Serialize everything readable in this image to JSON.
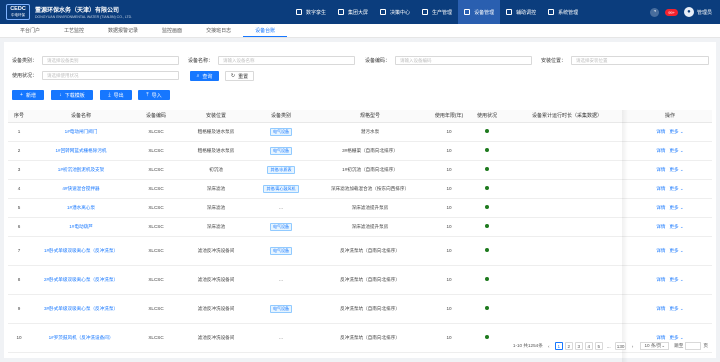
{
  "header": {
    "logo_badge": "CEDC",
    "logo_badge_sub": "中电环保",
    "company_name": "董源环保水务（天津）有限公司",
    "company_en": "DONGYUAN ENVIRONMENTAL WATER (TIANJIN) CO., LTD.",
    "nav": [
      {
        "label": "数字孪生",
        "icon": "twin-icon"
      },
      {
        "label": "集团大屏",
        "icon": "screen-icon"
      },
      {
        "label": "决策中心",
        "icon": "decision-icon"
      },
      {
        "label": "生产管理",
        "icon": "production-icon"
      },
      {
        "label": "设备管理",
        "icon": "device-icon"
      },
      {
        "label": "辅助调控",
        "icon": "control-icon"
      },
      {
        "label": "系统管理",
        "icon": "system-icon"
      }
    ],
    "active_nav": 4,
    "notification_count": "99+",
    "user_name": "管理员"
  },
  "tabs": [
    "平台门户",
    "工艺监控",
    "数据报警记录",
    "监控画面",
    "交接班日志",
    "设备台账"
  ],
  "active_tab": 5,
  "filters": {
    "device_category_label": "设备类别：",
    "device_category_placeholder": "请选择设备类别",
    "device_name_label": "设备名称：",
    "device_name_placeholder": "请输入设备名称",
    "device_code_label": "设备编码：",
    "device_code_placeholder": "请输入设备编码",
    "install_location_label": "安装位置：",
    "install_location_placeholder": "请选择安装位置",
    "usage_status_label": "使用状况：",
    "usage_status_placeholder": "请选择使用状况"
  },
  "buttons": {
    "query": "查询",
    "reset": "重置",
    "add": "新增",
    "download_template": "下载模板",
    "export": "导出",
    "import": "导入"
  },
  "table": {
    "columns": [
      "序号",
      "设备名称",
      "设备编码",
      "安装位置",
      "设备类别",
      "规格型号",
      "使用年限(年)",
      "使用状况",
      "设备累计运行时长（采集数据）",
      "操作"
    ],
    "rows": [
      {
        "no": "1",
        "name": "1#电动闸门阀门",
        "code": "XLCSC",
        "location": "粗格栅及进水泵房",
        "category": "电气设备",
        "model": "潜污水泵",
        "years": "10"
      },
      {
        "no": "2",
        "name": "1#回转网篮式栅格除污机",
        "code": "XLCSC",
        "location": "粗格栅及进水泵房",
        "category": "电气设备",
        "model": "3#格栅渠（自南向北排序）",
        "years": "10"
      },
      {
        "no": "3",
        "name": "1#初沉池刮泥机及支架",
        "code": "XLCSC",
        "location": "初沉池",
        "category": "其他/水质表",
        "model": "1#初沉池（自南向北排序）",
        "years": "10"
      },
      {
        "no": "4",
        "name": "4#快速混合搅拌器",
        "code": "XLCSC",
        "location": "深床滤池",
        "category": "其他/离心鼓风机",
        "model": "深床滤池加载混合池（按东向西排序）",
        "years": "10"
      },
      {
        "no": "5",
        "name": "1#潜水离心泵",
        "code": "XLCSC",
        "location": "深床滤池",
        "category": "...",
        "model": "深床滤池提升泵房",
        "years": "10"
      },
      {
        "no": "6",
        "name": "1#电动葫芦",
        "code": "XLCSC",
        "location": "深床滤池",
        "category": "电气设备",
        "model": "深床滤池提升泵房",
        "years": "10"
      },
      {
        "no": "7",
        "name": "1#卧式单级双吸离心泵（反冲洗泵）",
        "code": "XLCSC",
        "location": "滤池反冲洗设备间",
        "category": "电气设备",
        "model": "反冲洗泵坑（自南向北排序）",
        "years": "10"
      },
      {
        "no": "8",
        "name": "2#卧式单级双吸离心泵（反冲洗泵）",
        "code": "XLCSC",
        "location": "滤池反冲洗设备间",
        "category": "...",
        "model": "反冲洗泵坑（自南向北排序）",
        "years": "10"
      },
      {
        "no": "9",
        "name": "3#卧式单级双吸离心泵（反冲洗泵）",
        "code": "XLCSC",
        "location": "滤池反冲洗设备间",
        "category": "电气设备",
        "model": "反冲洗泵坑（自南向北排序）",
        "years": "10"
      },
      {
        "no": "10",
        "name": "1#罗茨鼓风机（反冲洗设备间）",
        "code": "XLCSC",
        "location": "滤池反冲洗设备间",
        "category": "...",
        "model": "反冲洗泵坑（自南向北排序）",
        "years": "10"
      }
    ],
    "op_detail": "详情",
    "op_more": "更多",
    "status_color": "#1e7a1e"
  },
  "pagination": {
    "summary": "1-10 共1254条",
    "pages": [
      "1",
      "2",
      "3",
      "4",
      "5",
      "...",
      "130"
    ],
    "current": "1",
    "page_size": "10 条/页",
    "jump_label": "跳至",
    "jump_suffix": "页"
  },
  "colors": {
    "primary": "#1677ff",
    "header": "#0b3d7d"
  }
}
